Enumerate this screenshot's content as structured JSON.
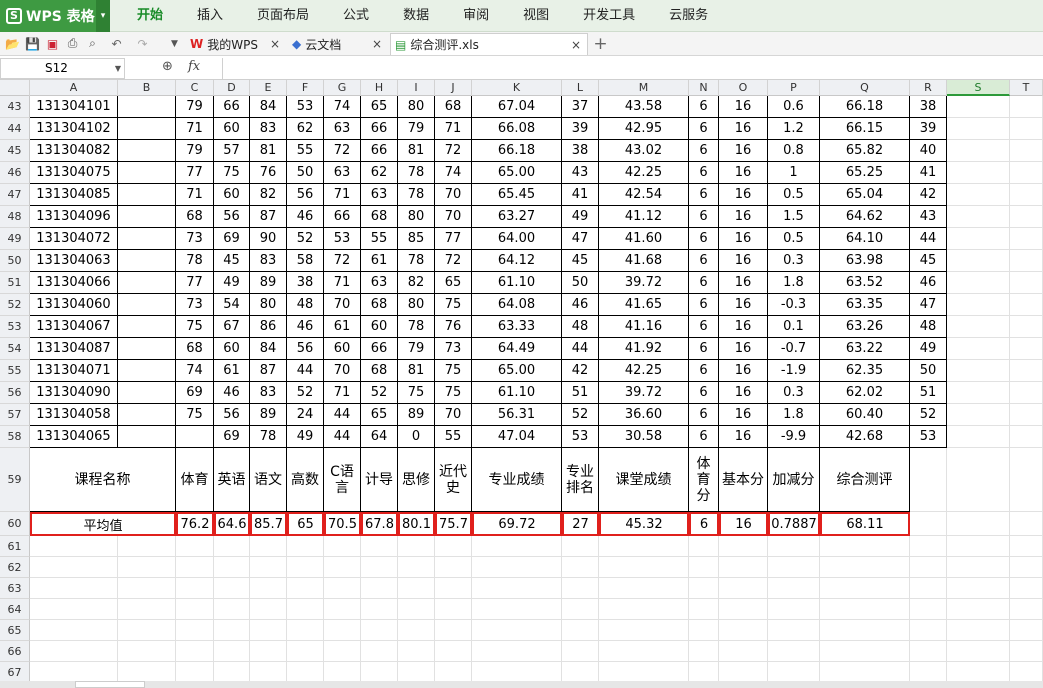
{
  "app": {
    "logo": "WPS 表格"
  },
  "menus": [
    "开始",
    "插入",
    "页面布局",
    "公式",
    "数据",
    "审阅",
    "视图",
    "开发工具",
    "云服务"
  ],
  "tabs": [
    {
      "label": "我的WPS"
    },
    {
      "label": "云文档"
    },
    {
      "label": "综合测评.xls"
    }
  ],
  "formula_bar": {
    "name_box": "S12",
    "fx": "fx",
    "value": ""
  },
  "columns": [
    "A",
    "B",
    "C",
    "D",
    "E",
    "F",
    "G",
    "H",
    "I",
    "J",
    "K",
    "L",
    "M",
    "N",
    "O",
    "P",
    "Q",
    "R",
    "S",
    "T"
  ],
  "selected_column": "S",
  "data_rows": [
    {
      "row": "43",
      "id": "131304101",
      "c": [
        "79",
        "66",
        "84",
        "53",
        "74",
        "65",
        "80",
        "68"
      ],
      "k": "67.04",
      "l": "37",
      "m": "43.58",
      "n": "6",
      "o": "16",
      "p": "0.6",
      "q": "66.18",
      "r": "38"
    },
    {
      "row": "44",
      "id": "131304102",
      "c": [
        "71",
        "60",
        "83",
        "62",
        "63",
        "66",
        "79",
        "71"
      ],
      "k": "66.08",
      "l": "39",
      "m": "42.95",
      "n": "6",
      "o": "16",
      "p": "1.2",
      "q": "66.15",
      "r": "39"
    },
    {
      "row": "45",
      "id": "131304082",
      "c": [
        "79",
        "57",
        "81",
        "55",
        "72",
        "66",
        "81",
        "72"
      ],
      "k": "66.18",
      "l": "38",
      "m": "43.02",
      "n": "6",
      "o": "16",
      "p": "0.8",
      "q": "65.82",
      "r": "40"
    },
    {
      "row": "46",
      "id": "131304075",
      "c": [
        "77",
        "75",
        "76",
        "50",
        "63",
        "62",
        "78",
        "74"
      ],
      "k": "65.00",
      "l": "43",
      "m": "42.25",
      "n": "6",
      "o": "16",
      "p": "1",
      "q": "65.25",
      "r": "41"
    },
    {
      "row": "47",
      "id": "131304085",
      "c": [
        "71",
        "60",
        "82",
        "56",
        "71",
        "63",
        "78",
        "70"
      ],
      "k": "65.45",
      "l": "41",
      "m": "42.54",
      "n": "6",
      "o": "16",
      "p": "0.5",
      "q": "65.04",
      "r": "42"
    },
    {
      "row": "48",
      "id": "131304096",
      "c": [
        "68",
        "56",
        "87",
        "46",
        "66",
        "68",
        "80",
        "70"
      ],
      "k": "63.27",
      "l": "49",
      "m": "41.12",
      "n": "6",
      "o": "16",
      "p": "1.5",
      "q": "64.62",
      "r": "43"
    },
    {
      "row": "49",
      "id": "131304072",
      "c": [
        "73",
        "69",
        "90",
        "52",
        "53",
        "55",
        "85",
        "77"
      ],
      "k": "64.00",
      "l": "47",
      "m": "41.60",
      "n": "6",
      "o": "16",
      "p": "0.5",
      "q": "64.10",
      "r": "44"
    },
    {
      "row": "50",
      "id": "131304063",
      "c": [
        "78",
        "45",
        "83",
        "58",
        "72",
        "61",
        "78",
        "72"
      ],
      "k": "64.12",
      "l": "45",
      "m": "41.68",
      "n": "6",
      "o": "16",
      "p": "0.3",
      "q": "63.98",
      "r": "45"
    },
    {
      "row": "51",
      "id": "131304066",
      "c": [
        "77",
        "49",
        "89",
        "38",
        "71",
        "63",
        "82",
        "65"
      ],
      "k": "61.10",
      "l": "50",
      "m": "39.72",
      "n": "6",
      "o": "16",
      "p": "1.8",
      "q": "63.52",
      "r": "46"
    },
    {
      "row": "52",
      "id": "131304060",
      "c": [
        "73",
        "54",
        "80",
        "48",
        "70",
        "68",
        "80",
        "75"
      ],
      "k": "64.08",
      "l": "46",
      "m": "41.65",
      "n": "6",
      "o": "16",
      "p": "-0.3",
      "q": "63.35",
      "r": "47"
    },
    {
      "row": "53",
      "id": "131304067",
      "c": [
        "75",
        "67",
        "86",
        "46",
        "61",
        "60",
        "78",
        "76"
      ],
      "k": "63.33",
      "l": "48",
      "m": "41.16",
      "n": "6",
      "o": "16",
      "p": "0.1",
      "q": "63.26",
      "r": "48"
    },
    {
      "row": "54",
      "id": "131304087",
      "c": [
        "68",
        "60",
        "84",
        "56",
        "60",
        "66",
        "79",
        "73"
      ],
      "k": "64.49",
      "l": "44",
      "m": "41.92",
      "n": "6",
      "o": "16",
      "p": "-0.7",
      "q": "63.22",
      "r": "49"
    },
    {
      "row": "55",
      "id": "131304071",
      "c": [
        "74",
        "61",
        "87",
        "44",
        "70",
        "68",
        "81",
        "75"
      ],
      "k": "65.00",
      "l": "42",
      "m": "42.25",
      "n": "6",
      "o": "16",
      "p": "-1.9",
      "q": "62.35",
      "r": "50"
    },
    {
      "row": "56",
      "id": "131304090",
      "c": [
        "69",
        "46",
        "83",
        "52",
        "71",
        "52",
        "75",
        "75"
      ],
      "k": "61.10",
      "l": "51",
      "m": "39.72",
      "n": "6",
      "o": "16",
      "p": "0.3",
      "q": "62.02",
      "r": "51"
    },
    {
      "row": "57",
      "id": "131304058",
      "c": [
        "75",
        "56",
        "89",
        "24",
        "44",
        "65",
        "89",
        "70"
      ],
      "k": "56.31",
      "l": "52",
      "m": "36.60",
      "n": "6",
      "o": "16",
      "p": "1.8",
      "q": "60.40",
      "r": "52"
    },
    {
      "row": "58",
      "id": "131304065",
      "c": [
        "",
        "69",
        "78",
        "49",
        "44",
        "64",
        "0",
        "55"
      ],
      "k": "47.04",
      "l": "53",
      "m": "30.58",
      "n": "6",
      "o": "16",
      "p": "-9.9",
      "q": "42.68",
      "r": "53"
    }
  ],
  "header_row": {
    "row": "59",
    "labels": [
      "课程名称",
      "体育",
      "英语",
      "语文",
      "高数",
      "C语言",
      "计导",
      "思修",
      "近代史",
      "专业成绩",
      "专业排名",
      "课堂成绩",
      "体育分",
      "基本分",
      "加减分",
      "综合测评"
    ]
  },
  "average_row": {
    "row": "60",
    "values": [
      "平均值",
      "76.2",
      "64.6",
      "85.7",
      "65",
      "70.5",
      "67.8",
      "80.1",
      "75.7",
      "69.72",
      "27",
      "45.32",
      "6",
      "16",
      "0.7887",
      "68.11"
    ]
  },
  "empty_rows": [
    "61",
    "62",
    "63",
    "64",
    "65",
    "66",
    "67"
  ]
}
